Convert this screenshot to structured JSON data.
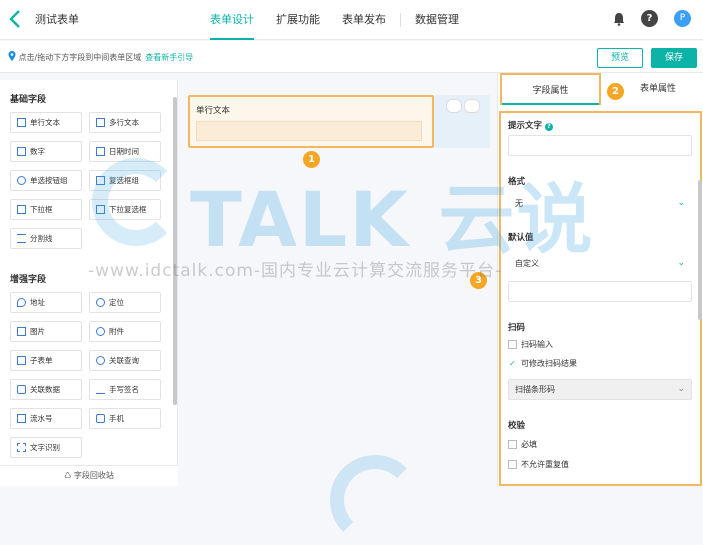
{
  "header": {
    "title": "测试表单",
    "tabs": [
      {
        "label": "表单设计",
        "active": true
      },
      {
        "label": "扩展功能",
        "active": false
      },
      {
        "label": "表单发布",
        "active": false
      },
      {
        "label": "数据管理",
        "active": false
      }
    ],
    "avatar_text": "P"
  },
  "subbar": {
    "hint": "点击/拖动下方字段到中间表单区域",
    "guide_link": "查看新手引导",
    "preview_label": "预览",
    "save_label": "保存"
  },
  "left_panel": {
    "basic_title": "基础字段",
    "basic_fields": [
      "单行文本",
      "多行文本",
      "数字",
      "日期时间",
      "单选按钮组",
      "复选框组",
      "下拉框",
      "下拉复选框",
      "分割线"
    ],
    "enhanced_title": "增强字段",
    "enhanced_fields": [
      "地址",
      "定位",
      "图片",
      "附件",
      "子表单",
      "关联查询",
      "关联数据",
      "手写签名",
      "流水号",
      "手机",
      "文字识别"
    ],
    "recycle_label": "字段回收站"
  },
  "canvas": {
    "field_label": "单行文本"
  },
  "right_panel": {
    "tab_field_props": "字段属性",
    "tab_form_props": "表单属性",
    "display_text_label": "提示文字",
    "format_label": "格式",
    "format_value": "无",
    "default_label": "默认值",
    "default_value": "自定义",
    "scan_label": "扫码",
    "scan_input": "扫码输入",
    "scan_editable": "可修改扫码结果",
    "scan_type": "扫描条形码",
    "verify_label": "校验",
    "required": "必填",
    "no_duplicate": "不允许重复值"
  },
  "badges": [
    "1",
    "2",
    "3"
  ],
  "watermark": {
    "logo": "TALK 云说",
    "url": "-www.idctalk.com-国内专业云计算交流服务平台-"
  },
  "colors": {
    "accent": "#0db3a6",
    "highlight": "#f0b860",
    "badge": "#f5a623"
  }
}
